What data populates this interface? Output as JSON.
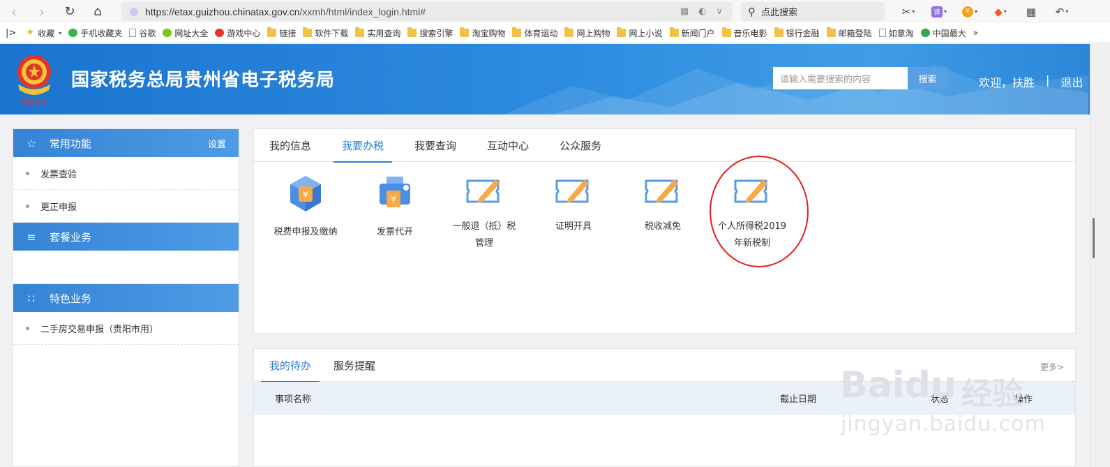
{
  "browser": {
    "url_host": "https://etax.guizhou.chinatax.gov.cn",
    "url_path": "/xxmh/html/index_login.html#",
    "search_text": "点此搜索",
    "toolbar_badges": {
      "translate": "译",
      "money": "¥"
    },
    "bookmarks": [
      {
        "label": "收藏",
        "icon": "star-icon"
      },
      {
        "label": "手机收藏夹",
        "icon": "phone-icon"
      },
      {
        "label": "谷歌",
        "icon": "page-icon"
      },
      {
        "label": "网址大全",
        "icon": "globe-icon"
      },
      {
        "label": "游戏中心",
        "icon": "game-icon"
      },
      {
        "label": "链接",
        "icon": "folder-icon"
      },
      {
        "label": "软件下载",
        "icon": "folder-icon"
      },
      {
        "label": "实用查询",
        "icon": "folder-icon"
      },
      {
        "label": "搜索引擎",
        "icon": "folder-icon"
      },
      {
        "label": "淘宝购物",
        "icon": "folder-icon"
      },
      {
        "label": "体育运动",
        "icon": "folder-icon"
      },
      {
        "label": "网上购物",
        "icon": "folder-icon"
      },
      {
        "label": "网上小说",
        "icon": "folder-icon"
      },
      {
        "label": "新闻门户",
        "icon": "folder-icon"
      },
      {
        "label": "音乐电影",
        "icon": "folder-icon"
      },
      {
        "label": "银行金融",
        "icon": "folder-icon"
      },
      {
        "label": "邮箱登陆",
        "icon": "folder-icon"
      },
      {
        "label": "如意淘",
        "icon": "page-icon"
      },
      {
        "label": "中国最大",
        "icon": "te-icon"
      }
    ],
    "bookmarks_more": "»"
  },
  "header": {
    "title": "国家税务总局贵州省电子税务局",
    "search_placeholder": "请输入需要搜索的内容",
    "search_button": "搜索",
    "welcome": "欢迎，扶胜",
    "logout": "退出",
    "logo_text": "中国税务"
  },
  "sidebar": {
    "common": {
      "title": "常用功能",
      "settings": "设置",
      "items": [
        "发票查验",
        "更正申报"
      ]
    },
    "package": {
      "title": "套餐业务"
    },
    "special": {
      "title": "特色业务",
      "items": [
        "二手房交易申报（贵阳市用）"
      ]
    }
  },
  "main": {
    "tabs": [
      "我的信息",
      "我要办税",
      "我要查询",
      "互动中心",
      "公众服务"
    ],
    "active_tab": "我要办税",
    "services": [
      {
        "line1": "税费申报及缴纳",
        "line2": ""
      },
      {
        "line1": "发票代开",
        "line2": ""
      },
      {
        "line1": "一般退（抵）税",
        "line2": "管理"
      },
      {
        "line1": "证明开具",
        "line2": ""
      },
      {
        "line1": "税收减免",
        "line2": ""
      },
      {
        "line1": "个人所得税2019",
        "line2": "年新税制"
      }
    ]
  },
  "todo": {
    "tabs": [
      "我的待办",
      "服务提醒"
    ],
    "more": "更多>",
    "columns": [
      "事项名称",
      "截止日期",
      "状态",
      "操作"
    ]
  },
  "watermark": {
    "brand": "Bai",
    "brand2": "du",
    "cn": "经验",
    "url": "jingyan.baidu.com"
  },
  "colors": {
    "brand_blue": "#2a7ad6",
    "highlight_red": "#e21d1d",
    "icon_blue": "#5b9ae8",
    "icon_orange": "#f5a947"
  }
}
